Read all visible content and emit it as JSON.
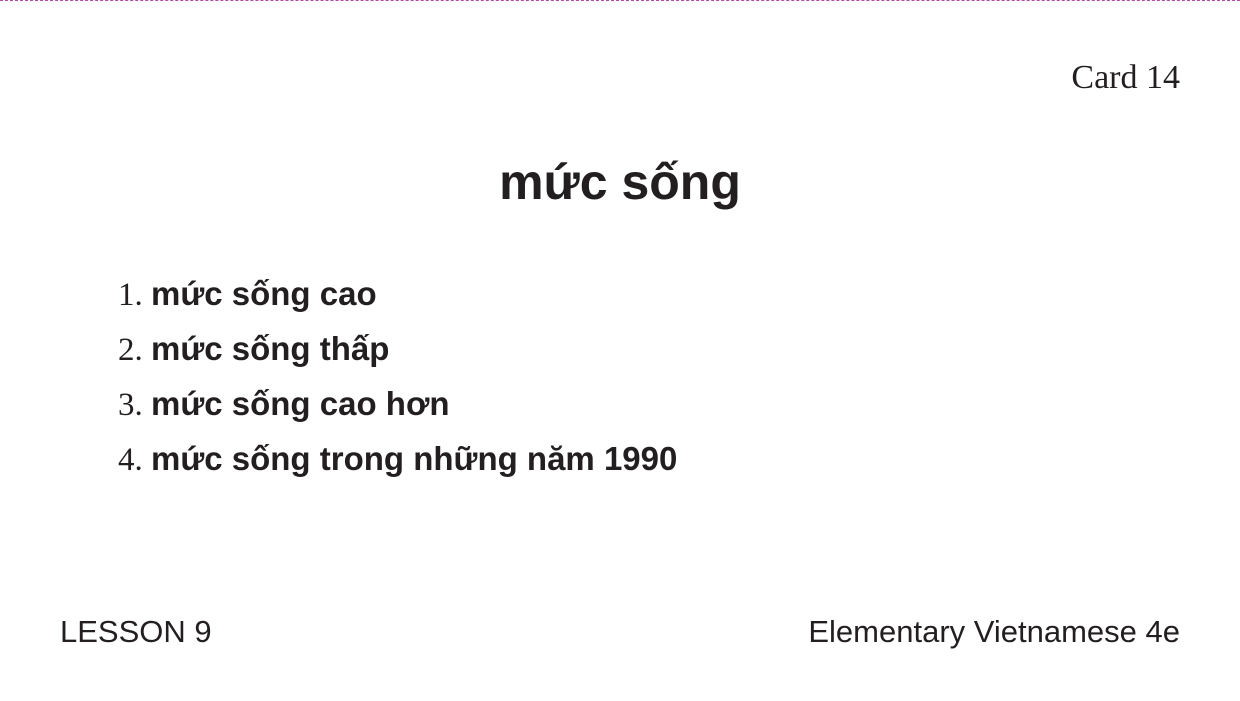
{
  "card": {
    "number_label": "Card 14",
    "headword": "mức sống",
    "phrases": [
      {
        "num": "1.",
        "text": "mức sống cao"
      },
      {
        "num": "2.",
        "text": "mức sống thấp"
      },
      {
        "num": "3.",
        "text": "mức sống cao hơn"
      },
      {
        "num": "4.",
        "text": "mức sống trong những năm 1990"
      }
    ],
    "lesson": "LESSON 9",
    "book_title": "Elementary Vietnamese 4e"
  },
  "colors": {
    "text": "#231f20",
    "cut_line": "#b14aa8",
    "background": "#ffffff"
  }
}
